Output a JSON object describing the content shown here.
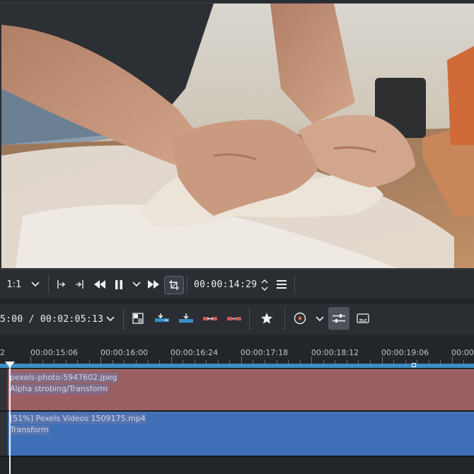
{
  "monitor": {
    "zoom_label": "1:1",
    "timecode": "00:00:14:29"
  },
  "timeline_toolbar": {
    "position_text": "5:00 / 00:02:05:13"
  },
  "ruler": {
    "first_label": "2",
    "labels": [
      "00:00:15:06",
      "00:00:16:00",
      "00:00:16:24",
      "00:00:17:18",
      "00:00:18:12",
      "00:00:19:06",
      "00:00"
    ]
  },
  "tracks": [
    {
      "clip_name": "pexels-photo-5947602.jpeg",
      "effects": "Alpha strobing/Transform",
      "color": "#9a5f62"
    },
    {
      "clip_name": "[51%] Pexels Videos 1509175.mp4",
      "effects": "Transform",
      "color": "#3f6fb6"
    }
  ],
  "icons": {
    "zoom_dropdown": "chevron-down-icon",
    "set_in": "set-zone-in-icon",
    "set_out": "set-zone-out-icon",
    "rewind": "rewind-icon",
    "pause": "pause-icon",
    "play_options": "chevron-down-icon",
    "forward": "fast-forward-icon",
    "crop": "crop-icon",
    "spin": "spinbox-arrows-icon",
    "menu": "hamburger-menu-icon"
  },
  "colors": {
    "accent": "#3b8ec6",
    "background": "#232629",
    "toolbar": "#2a2e32"
  }
}
